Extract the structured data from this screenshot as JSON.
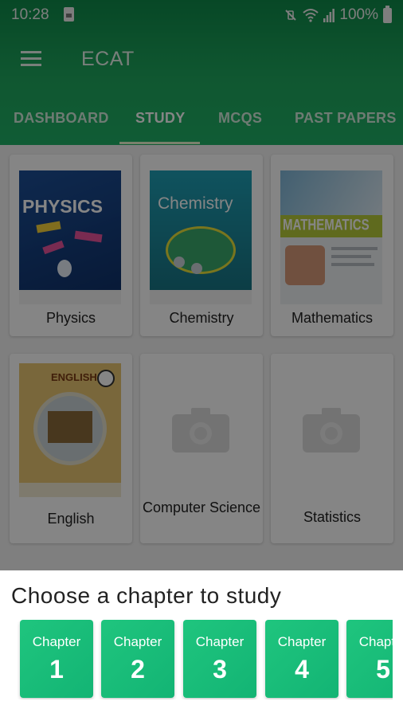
{
  "status_bar": {
    "time": "10:28",
    "battery_percent": "100%"
  },
  "toolbar": {
    "title": "ECAT"
  },
  "tabs": [
    {
      "label": "DASHBOARD"
    },
    {
      "label": "STUDY",
      "active": true
    },
    {
      "label": "MCQS"
    },
    {
      "label": "PAST PAPERS"
    }
  ],
  "subjects": [
    {
      "label": "Physics",
      "cover_text": "PHYSICS"
    },
    {
      "label": "Chemistry",
      "cover_text": "Chemistry"
    },
    {
      "label": "Mathematics",
      "cover_text": "MATHEMATICS"
    },
    {
      "label": "English",
      "cover_text": "ENGLISH"
    },
    {
      "label": "Computer Science"
    },
    {
      "label": "Statistics"
    }
  ],
  "sheet": {
    "title": "Choose a chapter to study",
    "chapter_word": "Chapter",
    "chapters": [
      "1",
      "2",
      "3",
      "4",
      "5"
    ]
  },
  "colors": {
    "primary_green": "#1fa85e",
    "chapter_green": "#1fc57e"
  }
}
